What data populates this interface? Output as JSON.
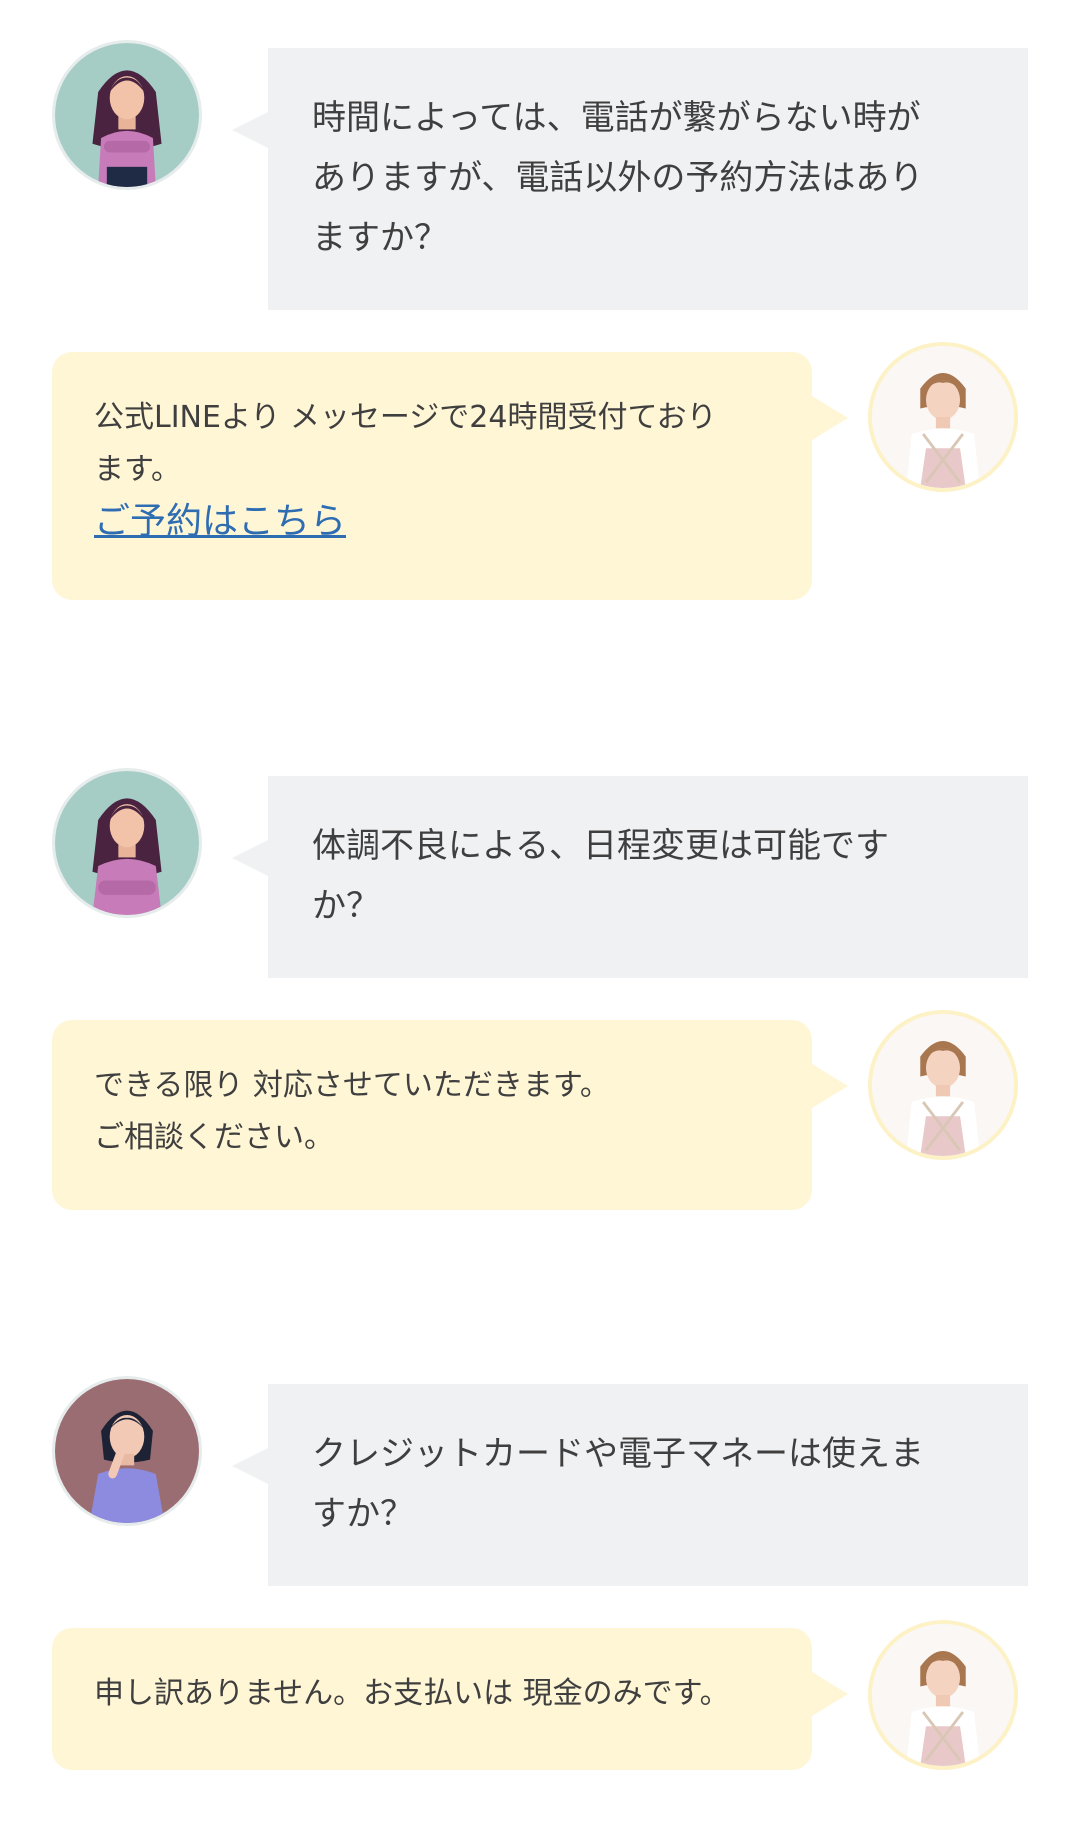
{
  "faq": [
    {
      "question_lines": [
        "時間によっては、電話が繋がらない時が",
        "ありますが、電話以外の予約方法はあり",
        "ますか？"
      ],
      "answer_lines": [
        "公式LINEより メッセージで24時間受付ており",
        "ます。"
      ],
      "answer_link": "ご予約はこちら"
    },
    {
      "question_lines": [
        "体調不良による、日程変更は可能です",
        "か？"
      ],
      "answer_lines": [
        "できる限り 対応させていただきます。",
        "ご相談ください。"
      ]
    },
    {
      "question_lines": [
        "クレジットカードや電子マネーは使えま",
        "すか？"
      ],
      "answer_lines": [
        "申し訳ありません。お支払いは 現金のみです。"
      ]
    }
  ],
  "colors": {
    "question_bubble": "#f0f1f3",
    "answer_bubble": "#fff6d6",
    "link": "#2f6db3"
  },
  "icons": {
    "customer": "customer-avatar-icon",
    "staff": "staff-avatar-icon"
  }
}
